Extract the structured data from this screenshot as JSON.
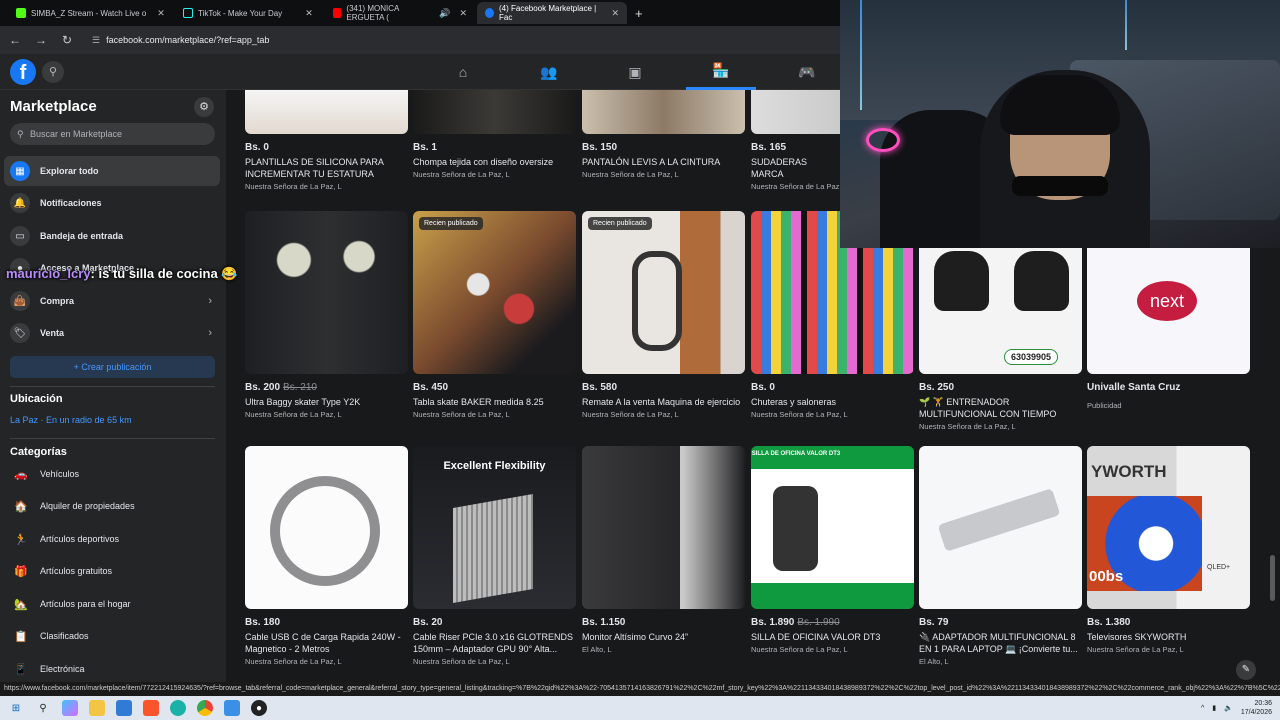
{
  "browser": {
    "tabs": [
      {
        "label": "SIMBA_Z Stream - Watch Live o",
        "color": "#53fc18"
      },
      {
        "label": "TikTok - Make Your Day",
        "color": "#111111"
      },
      {
        "label": "(341) MONICA ERGUETA (",
        "color": "#ff0000"
      },
      {
        "label": "(4) Facebook Marketplace | Fac",
        "color": "#1877f2"
      }
    ],
    "url": "facebook.com/marketplace/?ref=app_tab"
  },
  "sidebar": {
    "title": "Marketplace",
    "search_placeholder": "Buscar en Marketplace",
    "items": [
      {
        "label": "Explorar todo",
        "icon": "storefront-icon"
      },
      {
        "label": "Notificaciones",
        "icon": "bell-icon"
      },
      {
        "label": "Bandeja de entrada",
        "icon": "inbox-icon"
      },
      {
        "label": "Acceso a Marketplace",
        "icon": "account-icon"
      },
      {
        "label": "Compra",
        "icon": "bag-icon"
      },
      {
        "label": "Venta",
        "icon": "tag-icon"
      }
    ],
    "create_label": "+ Crear publicación",
    "location_heading": "Ubicación",
    "location_value": "La Paz · En un radio de 65 km",
    "categories_heading": "Categorías",
    "categories": [
      "Vehículos",
      "Alquiler de propiedades",
      "Artículos deportivos",
      "Artículos gratuitos",
      "Artículos para el hogar",
      "Clasificados",
      "Electrónica"
    ]
  },
  "chat_overlay": {
    "user": "mauricio_lcry",
    "message": ": is tu silla de cocina 😂"
  },
  "listings_row0": [
    {
      "price": "Bs. 0",
      "old": "",
      "title": "PLANTILLAS DE SILICONA PARA INCREMENTAR TU ESTATURA",
      "location": "Nuestra Señora de La Paz, L"
    },
    {
      "price": "Bs. 1",
      "old": "",
      "title": "Chompa tejida con diseño oversize",
      "location": "Nuestra Señora de La Paz, L"
    },
    {
      "price": "Bs. 150",
      "old": "",
      "title": "PANTALÓN LEVIS A LA CINTURA",
      "location": "Nuestra Señora de La Paz, L"
    },
    {
      "price": "Bs. 165",
      "old": "",
      "title": "SUDADERAS MARCA",
      "location": "Nuestra Señora de La Paz, L"
    }
  ],
  "listings_row1": [
    {
      "price": "Bs. 200",
      "old": "Bs. 210",
      "title": "Ultra Baggy skater Type Y2K",
      "location": "Nuestra Señora de La Paz, L",
      "badge": ""
    },
    {
      "price": "Bs. 450",
      "old": "",
      "title": "Tabla skate BAKER medida 8.25",
      "location": "Nuestra Señora de La Paz, L",
      "badge": "Recien publicado"
    },
    {
      "price": "Bs. 580",
      "old": "",
      "title": "Remate A la venta Maquina de ejercicio",
      "location": "Nuestra Señora de La Paz, L",
      "badge": "Recien publicado"
    },
    {
      "price": "Bs. 0",
      "old": "",
      "title": "Chuteras y saloneras",
      "location": "Nuestra Señora de La Paz, L",
      "badge": ""
    },
    {
      "price": "Bs. 250",
      "old": "",
      "title": "🌱 🏋 ENTRENADOR MULTIFUNCIONAL CON TIEMPO PAR...",
      "location": "Nuestra Señora de La Paz, L",
      "badge": ""
    },
    {
      "price": "Univalle Santa Cruz",
      "old": "",
      "title": "",
      "location": "Publicidad",
      "badge": ""
    }
  ],
  "listings_row2": [
    {
      "price": "Bs. 180",
      "old": "",
      "title": "Cable USB C de Carga Rapida 240W - Magnetico - 2 Metros",
      "location": "Nuestra Señora de La Paz, L"
    },
    {
      "price": "Bs. 20",
      "old": "",
      "title": "Cable Riser PCIe 3.0 x16 GLOTRENDS 150mm – Adaptador GPU 90° Alta...",
      "location": "Nuestra Señora de La Paz, L"
    },
    {
      "price": "Bs. 1.150",
      "old": "",
      "title": "Monitor Altísimo Curvo 24”",
      "location": "El Alto, L"
    },
    {
      "price": "Bs. 1.890",
      "old": "Bs. 1.990",
      "title": "SILLA DE OFICINA VALOR DT3",
      "location": "Nuestra Señora de La Paz, L"
    },
    {
      "price": "Bs. 79",
      "old": "",
      "title": "🔌 ADAPTADOR MULTIFUNCIONAL 8 EN 1 PARA LAPTOP 💻 ¡Convierte tu...",
      "location": "El Alto, L"
    },
    {
      "price": "Bs. 1.380",
      "old": "",
      "title": "Televisores SKYWORTH",
      "location": "Nuestra Señora de La Paz, L"
    }
  ],
  "image_text": {
    "phone": "63039905",
    "unvalle": "next",
    "flex": "Excellent Flexibility",
    "silla": "SILLA DE OFICINA VALOR DT3",
    "sky": "YWORTH",
    "sky2": "00bs",
    "qled": "QLED+"
  },
  "status_url": "https://www.facebook.com/marketplace/item/772212415924635/?ref=browse_tab&referral_code=marketplace_general&referral_story_type=general_listing&tracking=%7B%22qid%22%3A%22-7054135714163826791%22%2C%22mf_story_key%22%3A%221134334018438989372%22%2C%22top_level_post_id%22%3A%221134334018438989372%22%2C%22commerce_rank_obj%22%3A%22%7B%5C%22target_id%5C%22%3A1134334",
  "taskbar": {
    "time": "20:36",
    "date": "17/4/2026"
  }
}
